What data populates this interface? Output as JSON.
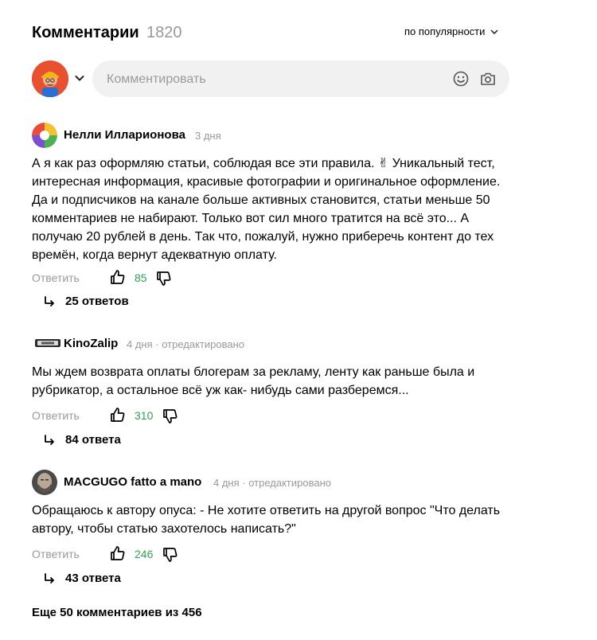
{
  "header": {
    "title": "Комментарии",
    "count": "1820",
    "sort_label": "по популярности"
  },
  "composer": {
    "placeholder": "Комментировать"
  },
  "comments": [
    {
      "author": "Нелли Илларионова",
      "time": "3 дня",
      "text": "А я как раз оформляю статьи, соблюдая все эти правила. ✌ Уникальный тест, интересная информация, красивые фотографии и оригинальное оформление. Да и подписчиков на канале больше активных становится, статьи меньше 50 комментариев не набирают. Только вот сил много тратится на всё это... А получаю 20 рублей в день. Так что, пожалуй, нужно приберечь контент до тех времён, когда вернут адекватную оплату.",
      "reply_label": "Ответить",
      "likes": "85",
      "replies_label": "25 ответов"
    },
    {
      "author": "KinoZalip",
      "time": "4 дня · отредактировано",
      "text": "Мы ждем возврата оплаты блогерам за рекламу, ленту как раньше была и рубрикатор, а остальное всё уж как- нибудь сами разберемся...",
      "reply_label": "Ответить",
      "likes": "310",
      "replies_label": "84 ответа"
    },
    {
      "author": "MACGUGO fatto a mano",
      "time": "4 дня · отредактировано",
      "text": "Обращаюсь к автору опуса: - Не хотите ответить на другой вопрос \"Что делать автору, чтобы статью захотелось написать?\"",
      "reply_label": "Ответить",
      "likes": "246",
      "replies_label": "43 ответа"
    }
  ],
  "footer": {
    "more_label": "Еще 50 комментариев из 456"
  },
  "colors": {
    "likes": "#2ea44f",
    "muted": "#999999",
    "composer_bg": "#f1f1f1"
  }
}
